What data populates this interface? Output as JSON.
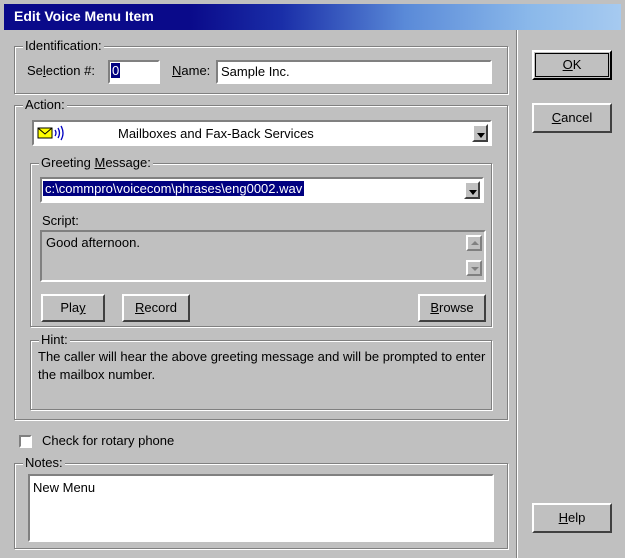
{
  "window": {
    "title": "Edit Voice Menu Item"
  },
  "identification": {
    "legend": "Identification:",
    "selection_label_pre": "Se",
    "selection_label_u": "l",
    "selection_label_post": "ection #:",
    "selection_value": "0",
    "name_label_u": "N",
    "name_label_post": "ame:",
    "name_value": "Sample Inc."
  },
  "action": {
    "legend": "Action:",
    "selected": "Mailboxes and Fax-Back Services",
    "icon": "mailbox-sound-icon",
    "greeting": {
      "legend_pre": "Greeting ",
      "legend_u": "M",
      "legend_post": "essage:",
      "file": "c:\\commpro\\voicecom\\phrases\\eng0002.wav"
    },
    "script": {
      "label": "Script:",
      "text": "Good afternoon."
    },
    "buttons": {
      "play_pre": "Pla",
      "play_u": "y",
      "record_u": "R",
      "record_post": "ecord",
      "browse_u": "B",
      "browse_post": "rowse"
    },
    "hint": {
      "legend": "Hint:",
      "text": "The caller will hear the above greeting message and will be prompted to enter the mailbox number."
    }
  },
  "rotary": {
    "label": "Check for rotary phone",
    "checked": false
  },
  "notes": {
    "legend": "Notes:",
    "text": "New Menu"
  },
  "side_buttons": {
    "ok_u": "O",
    "ok_post": "K",
    "cancel_u": "C",
    "cancel_post": "ancel",
    "help_u": "H",
    "help_post": "elp"
  },
  "colors": {
    "face": "#c0c0c0",
    "title_start": "#0a0a8a",
    "title_end": "#a6caf0",
    "selection": "#000080"
  }
}
